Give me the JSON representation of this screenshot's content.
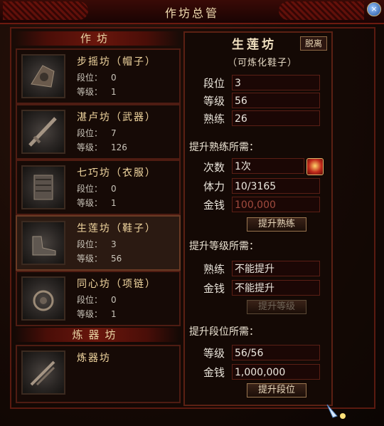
{
  "window": {
    "title": "作坊总管"
  },
  "left": {
    "section_title": "作坊",
    "workshops": [
      {
        "name": "步摇坊（帽子）",
        "rank_label": "段位：",
        "rank": "0",
        "level_label": "等级：",
        "level": "1",
        "icon": "hat-icon"
      },
      {
        "name": "湛卢坊（武器）",
        "rank_label": "段位：",
        "rank": "7",
        "level_label": "等级：",
        "level": "126",
        "icon": "sword-icon"
      },
      {
        "name": "七巧坊（衣服）",
        "rank_label": "段位：",
        "rank": "0",
        "level_label": "等级：",
        "level": "1",
        "icon": "armor-icon"
      },
      {
        "name": "生莲坊（鞋子）",
        "rank_label": "段位：",
        "rank": "3",
        "level_label": "等级：",
        "level": "56",
        "icon": "shoe-icon"
      },
      {
        "name": "同心坊（项链）",
        "rank_label": "段位：",
        "rank": "0",
        "level_label": "等级：",
        "level": "1",
        "icon": "necklace-icon"
      }
    ],
    "refinery_section_title": "炼器坊",
    "refinery": {
      "name": "炼器坊",
      "icon": "blade-icon"
    }
  },
  "detail": {
    "title": "生莲坊",
    "detach_label": "脱离",
    "subtitle": "（可炼化鞋子）",
    "stats": {
      "rank_label": "段位",
      "rank": "3",
      "level_label": "等级",
      "level": "56",
      "skill_label": "熟练",
      "skill": "26"
    },
    "skill_up": {
      "heading": "提升熟练所需：",
      "count_label": "次数",
      "count": "1次",
      "stamina_label": "体力",
      "stamina": "10/3165",
      "money_label": "金钱",
      "money": "100,000",
      "button": "提升熟练"
    },
    "level_up": {
      "heading": "提升等级所需：",
      "skill_label": "熟练",
      "skill": "不能提升",
      "money_label": "金钱",
      "money": "不能提升",
      "button": "提升等级"
    },
    "rank_up": {
      "heading": "提升段位所需：",
      "level_label": "等级",
      "level": "56/56",
      "money_label": "金钱",
      "money": "1,000,000",
      "button": "提升段位"
    }
  },
  "colors": {
    "accent_red": "#6d1a0f",
    "text_gold": "#f2d7a0",
    "money_red": "#a14b3e"
  }
}
